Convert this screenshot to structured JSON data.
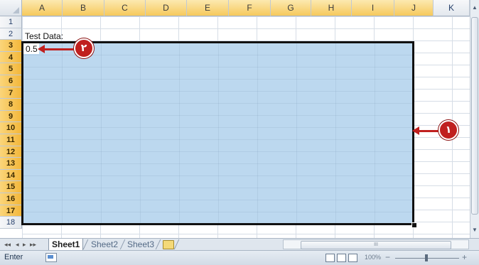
{
  "columns": [
    "A",
    "B",
    "C",
    "D",
    "E",
    "F",
    "G",
    "H",
    "I",
    "J",
    "K"
  ],
  "rows": [
    "1",
    "2",
    "3",
    "4",
    "5",
    "6",
    "7",
    "8",
    "9",
    "10",
    "11",
    "12",
    "13",
    "14",
    "15",
    "16",
    "17",
    "18"
  ],
  "cells": {
    "a2": "Test Data:",
    "a3": "0.5"
  },
  "callouts": {
    "one": "١",
    "two": "٢"
  },
  "sheet_nav": {
    "first": "◂◂",
    "prev": "◂",
    "next": "▸",
    "last": "▸▸"
  },
  "sheets": [
    "Sheet1",
    "Sheet2",
    "Sheet3"
  ],
  "active_sheet": "Sheet1",
  "status": {
    "mode": "Enter",
    "zoom": "100%",
    "minus": "−",
    "plus": "+"
  },
  "hscroll_grip": "III",
  "colors": {
    "selection_fill": "#bcd8ef",
    "callout_red": "#c0201f",
    "header_highlight": "#f6c95c"
  }
}
